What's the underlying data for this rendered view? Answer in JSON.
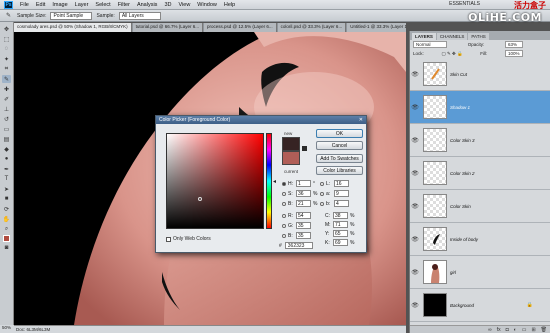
{
  "app": {
    "logo": "Ps",
    "menu": [
      "File",
      "Edit",
      "Image",
      "Layer",
      "Select",
      "Filter",
      "Analysis",
      "3D",
      "View",
      "Window",
      "Help"
    ],
    "workspace": "ESSENTIALS",
    "watermark_top": "活力盒子",
    "watermark": "OLiHE.COM"
  },
  "options_bar": {
    "sample_size_label": "Sample Size:",
    "sample_size_value": "Point Sample",
    "sample_label": "Sample:",
    "sample_value": "All Layers"
  },
  "tabs": [
    {
      "label": "cosmolady ares.psd @ 50% (Shadow 1, RGB/8/CMYK)",
      "active": true
    },
    {
      "label": "tutorial.psd @ 66.7% (Layer 6...",
      "active": false
    },
    {
      "label": "process.psd @ 12.5% (Layer 6...",
      "active": false
    },
    {
      "label": "coloril.psd @ 33.3% (Layer 6...",
      "active": false
    },
    {
      "label": "Untitled-1 @ 33.3% (Layer 1...",
      "active": false
    }
  ],
  "status": {
    "zoom": "50%",
    "doc": "Doc: 6L3M/6L3M"
  },
  "dialog": {
    "title": "Color Picker (Foreground Color)",
    "new_label": "new",
    "current_label": "current",
    "new_color": "#362323",
    "current_color": "#b05e57",
    "buttons": {
      "ok": "OK",
      "cancel": "Cancel",
      "add_swatches": "Add To Swatches",
      "color_libraries": "Color Libraries"
    },
    "only_web_colors": "Only Web Colors",
    "fields_left": [
      {
        "key": "H:",
        "value": "1",
        "unit": "°",
        "on": true
      },
      {
        "key": "S:",
        "value": "36",
        "unit": "%",
        "on": false
      },
      {
        "key": "B:",
        "value": "21",
        "unit": "%",
        "on": false
      },
      {
        "key": "R:",
        "value": "54",
        "unit": "",
        "on": false
      },
      {
        "key": "G:",
        "value": "35",
        "unit": "",
        "on": false
      },
      {
        "key": "B:",
        "value": "35",
        "unit": "",
        "on": false
      }
    ],
    "fields_right": [
      {
        "key": "L:",
        "value": "16",
        "unit": ""
      },
      {
        "key": "a:",
        "value": "9",
        "unit": ""
      },
      {
        "key": "b:",
        "value": "4",
        "unit": ""
      },
      {
        "key": "C:",
        "value": "38",
        "unit": "%"
      },
      {
        "key": "M:",
        "value": "71",
        "unit": "%"
      },
      {
        "key": "Y:",
        "value": "65",
        "unit": "%"
      },
      {
        "key": "K:",
        "value": "69",
        "unit": "%"
      }
    ],
    "hex_label": "#",
    "hex": "362323"
  },
  "layers_panel": {
    "tabs": [
      "LAYERS",
      "CHANNELS",
      "PATHS"
    ],
    "blend_mode": "Normal",
    "opacity_label": "Opacity:",
    "opacity": "63%",
    "lock_label": "Lock:",
    "fill_label": "Fill:",
    "fill": "100%",
    "layers": [
      {
        "name": "Skin Cut",
        "selected": false
      },
      {
        "name": "Shadow 1",
        "selected": true
      },
      {
        "name": "Color Skin 3",
        "selected": false
      },
      {
        "name": "Color Skin 2",
        "selected": false
      },
      {
        "name": "Color Skin",
        "selected": false
      },
      {
        "name": "Inside of body",
        "selected": false
      },
      {
        "name": "girl",
        "selected": false
      },
      {
        "name": "Background",
        "selected": false
      }
    ]
  }
}
